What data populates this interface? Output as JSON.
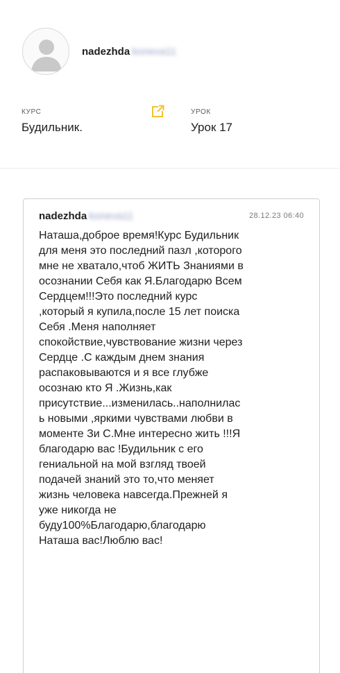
{
  "profile": {
    "first_name": "nadezhda",
    "last_name_blurred": "koneva11"
  },
  "course": {
    "label": "КУРС",
    "value": "Будильник."
  },
  "lesson": {
    "label": "УРОК",
    "value": "Урок 17"
  },
  "comment": {
    "author_first": "nadezhda",
    "author_last_blurred": "koneva11",
    "date": "28.12.23 06:40",
    "text": "Наташа,доброе время!Курс Будильник\nдля меня это последний пазл ,которого\nмне не хватало,чтоб  ЖИТЬ Знаниями в\nосознании Себя как Я.Благодарю Всем\nСердцем!!!Это последний курс\n,который я купила,после 15 лет поиска\nСебя .Меня наполняет\nспокойствие,чувствование жизни через\nСердце .С каждым днем знания\nраспаковываются и я все глубже\nосознаю кто Я  .Жизнь,как\nприсутствие...изменилась..наполнилас\nь новыми ,яркими чувствами любви в\nмоменте Зи  С.Мне интересно жить !!!Я\nблагодарю вас !Будильник с его\nгениальной на мой взгляд твоей\nподачей знаний это то,что меняет\nжизнь человека  навсегда.Прежней  я\nуже никогда не\nбуду100%Благодарю,благодарю\nНаташа  вас!Люблю вас!"
  },
  "icons": {
    "avatar": "user-avatar-icon",
    "external": "external-link-icon"
  },
  "colors": {
    "accent": "#f2c230",
    "text": "#1e1e1e",
    "muted": "#7a7a7a",
    "border": "#cfcfcf"
  }
}
